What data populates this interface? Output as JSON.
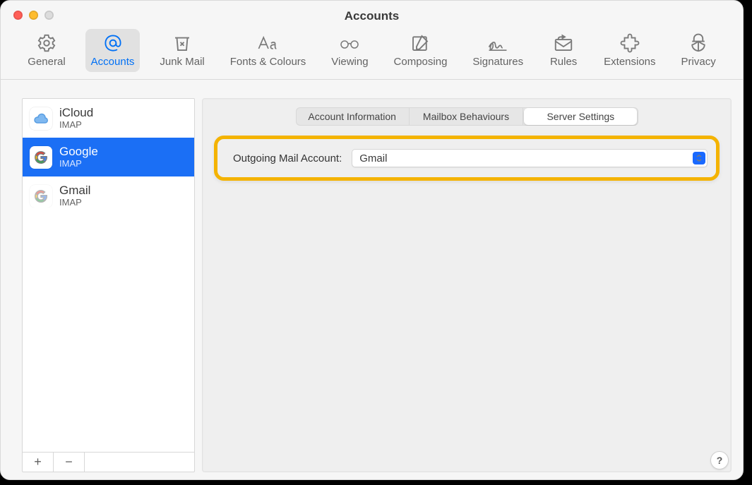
{
  "window": {
    "title": "Accounts"
  },
  "toolbar": [
    {
      "id": "general",
      "label": "General",
      "icon": "gear-icon"
    },
    {
      "id": "accounts",
      "label": "Accounts",
      "icon": "at-icon",
      "active": true
    },
    {
      "id": "junk",
      "label": "Junk Mail",
      "icon": "trash-x-icon"
    },
    {
      "id": "fonts",
      "label": "Fonts & Colours",
      "icon": "aa-icon"
    },
    {
      "id": "viewing",
      "label": "Viewing",
      "icon": "glasses-icon"
    },
    {
      "id": "composing",
      "label": "Composing",
      "icon": "compose-icon"
    },
    {
      "id": "signatures",
      "label": "Signatures",
      "icon": "signature-icon"
    },
    {
      "id": "rules",
      "label": "Rules",
      "icon": "rules-icon"
    },
    {
      "id": "extensions",
      "label": "Extensions",
      "icon": "extensions-icon"
    },
    {
      "id": "privacy",
      "label": "Privacy",
      "icon": "privacy-icon"
    }
  ],
  "accounts": [
    {
      "name": "iCloud",
      "type": "IMAP",
      "icon": "icloud"
    },
    {
      "name": "Google",
      "type": "IMAP",
      "icon": "google",
      "selected": true
    },
    {
      "name": "Gmail",
      "type": "IMAP",
      "icon": "gmail"
    }
  ],
  "sidebar_footer": {
    "plus": "+",
    "minus": "−"
  },
  "tabs": [
    {
      "label": "Account Information"
    },
    {
      "label": "Mailbox Behaviours"
    },
    {
      "label": "Server Settings",
      "active": true
    }
  ],
  "server_settings": {
    "outgoing_label": "Outgoing Mail Account:",
    "outgoing_value": "Gmail"
  },
  "help_label": "?"
}
